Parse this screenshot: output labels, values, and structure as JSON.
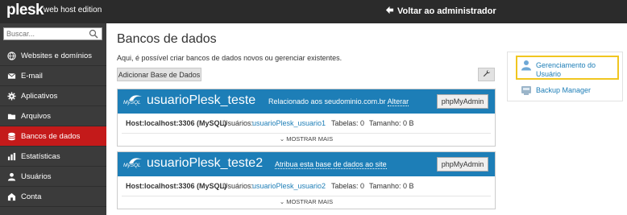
{
  "header": {
    "logo": "plesk",
    "logo_sub": "web host edition",
    "back_label": "Voltar ao administrador"
  },
  "sidebar": {
    "search_placeholder": "Buscar...",
    "items": [
      {
        "label": "Websites e domínios",
        "icon": "globe-icon"
      },
      {
        "label": "E-mail",
        "icon": "envelope-icon"
      },
      {
        "label": "Aplicativos",
        "icon": "gear-icon"
      },
      {
        "label": "Arquivos",
        "icon": "folder-icon"
      },
      {
        "label": "Bancos de dados",
        "icon": "database-icon",
        "active": true
      },
      {
        "label": "Estatísticas",
        "icon": "bar-chart-icon"
      },
      {
        "label": "Usuários",
        "icon": "user-icon"
      },
      {
        "label": "Conta",
        "icon": "account-icon"
      }
    ]
  },
  "main": {
    "title": "Bancos de dados",
    "description": "Aqui, é possível criar bancos de dados novos ou gerenciar existentes.",
    "add_button": "Adicionar Base de Dados",
    "databases": [
      {
        "mysql_label": "MySQL",
        "name": "usuarioPlesk_teste",
        "relation": "Relacionado aos seudominio.com.br",
        "relation_action": "Alterar",
        "phpmyadmin": "phpMyAdmin",
        "host": "Host:localhost:3306 (MySQL)",
        "users_label": "Usuários:",
        "user": "usuarioPlesk_usuario1",
        "tables": "Tabelas: 0",
        "size": "Tamanho: 0 B",
        "more": "MOSTRAR MAIS"
      },
      {
        "mysql_label": "MySQL",
        "name": "usuarioPlesk_teste2",
        "relation": "",
        "relation_action": "Atribua esta base de dados ao site",
        "phpmyadmin": "phpMyAdmin",
        "host": "Host:localhost:3306 (MySQL)",
        "users_label": "Usuários:",
        "user": "usuarioPlesk_usuario2",
        "tables": "Tabelas: 0",
        "size": "Tamanho: 0 B",
        "more": "MOSTRAR MAIS"
      }
    ]
  },
  "right_panel": {
    "user_management": "Gerenciamento do Usuário",
    "backup_manager": "Backup Manager"
  },
  "colors": {
    "topbar": "#2b2b2b",
    "sidebar": "#3b3b3b",
    "active_nav": "#c41a1a",
    "db_header": "#1d7eb7",
    "link": "#1d7eb7",
    "highlight": "#f0c620"
  }
}
